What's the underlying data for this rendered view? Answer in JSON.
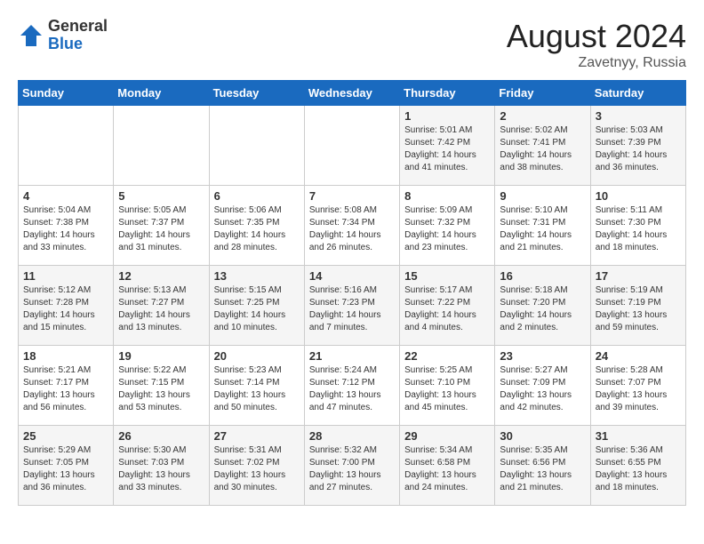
{
  "header": {
    "logo_general": "General",
    "logo_blue": "Blue",
    "title": "August 2024",
    "subtitle": "Zavetnyy, Russia"
  },
  "weekdays": [
    "Sunday",
    "Monday",
    "Tuesday",
    "Wednesday",
    "Thursday",
    "Friday",
    "Saturday"
  ],
  "weeks": [
    [
      {
        "day": "",
        "info": ""
      },
      {
        "day": "",
        "info": ""
      },
      {
        "day": "",
        "info": ""
      },
      {
        "day": "",
        "info": ""
      },
      {
        "day": "1",
        "info": "Sunrise: 5:01 AM\nSunset: 7:42 PM\nDaylight: 14 hours\nand 41 minutes."
      },
      {
        "day": "2",
        "info": "Sunrise: 5:02 AM\nSunset: 7:41 PM\nDaylight: 14 hours\nand 38 minutes."
      },
      {
        "day": "3",
        "info": "Sunrise: 5:03 AM\nSunset: 7:39 PM\nDaylight: 14 hours\nand 36 minutes."
      }
    ],
    [
      {
        "day": "4",
        "info": "Sunrise: 5:04 AM\nSunset: 7:38 PM\nDaylight: 14 hours\nand 33 minutes."
      },
      {
        "day": "5",
        "info": "Sunrise: 5:05 AM\nSunset: 7:37 PM\nDaylight: 14 hours\nand 31 minutes."
      },
      {
        "day": "6",
        "info": "Sunrise: 5:06 AM\nSunset: 7:35 PM\nDaylight: 14 hours\nand 28 minutes."
      },
      {
        "day": "7",
        "info": "Sunrise: 5:08 AM\nSunset: 7:34 PM\nDaylight: 14 hours\nand 26 minutes."
      },
      {
        "day": "8",
        "info": "Sunrise: 5:09 AM\nSunset: 7:32 PM\nDaylight: 14 hours\nand 23 minutes."
      },
      {
        "day": "9",
        "info": "Sunrise: 5:10 AM\nSunset: 7:31 PM\nDaylight: 14 hours\nand 21 minutes."
      },
      {
        "day": "10",
        "info": "Sunrise: 5:11 AM\nSunset: 7:30 PM\nDaylight: 14 hours\nand 18 minutes."
      }
    ],
    [
      {
        "day": "11",
        "info": "Sunrise: 5:12 AM\nSunset: 7:28 PM\nDaylight: 14 hours\nand 15 minutes."
      },
      {
        "day": "12",
        "info": "Sunrise: 5:13 AM\nSunset: 7:27 PM\nDaylight: 14 hours\nand 13 minutes."
      },
      {
        "day": "13",
        "info": "Sunrise: 5:15 AM\nSunset: 7:25 PM\nDaylight: 14 hours\nand 10 minutes."
      },
      {
        "day": "14",
        "info": "Sunrise: 5:16 AM\nSunset: 7:23 PM\nDaylight: 14 hours\nand 7 minutes."
      },
      {
        "day": "15",
        "info": "Sunrise: 5:17 AM\nSunset: 7:22 PM\nDaylight: 14 hours\nand 4 minutes."
      },
      {
        "day": "16",
        "info": "Sunrise: 5:18 AM\nSunset: 7:20 PM\nDaylight: 14 hours\nand 2 minutes."
      },
      {
        "day": "17",
        "info": "Sunrise: 5:19 AM\nSunset: 7:19 PM\nDaylight: 13 hours\nand 59 minutes."
      }
    ],
    [
      {
        "day": "18",
        "info": "Sunrise: 5:21 AM\nSunset: 7:17 PM\nDaylight: 13 hours\nand 56 minutes."
      },
      {
        "day": "19",
        "info": "Sunrise: 5:22 AM\nSunset: 7:15 PM\nDaylight: 13 hours\nand 53 minutes."
      },
      {
        "day": "20",
        "info": "Sunrise: 5:23 AM\nSunset: 7:14 PM\nDaylight: 13 hours\nand 50 minutes."
      },
      {
        "day": "21",
        "info": "Sunrise: 5:24 AM\nSunset: 7:12 PM\nDaylight: 13 hours\nand 47 minutes."
      },
      {
        "day": "22",
        "info": "Sunrise: 5:25 AM\nSunset: 7:10 PM\nDaylight: 13 hours\nand 45 minutes."
      },
      {
        "day": "23",
        "info": "Sunrise: 5:27 AM\nSunset: 7:09 PM\nDaylight: 13 hours\nand 42 minutes."
      },
      {
        "day": "24",
        "info": "Sunrise: 5:28 AM\nSunset: 7:07 PM\nDaylight: 13 hours\nand 39 minutes."
      }
    ],
    [
      {
        "day": "25",
        "info": "Sunrise: 5:29 AM\nSunset: 7:05 PM\nDaylight: 13 hours\nand 36 minutes."
      },
      {
        "day": "26",
        "info": "Sunrise: 5:30 AM\nSunset: 7:03 PM\nDaylight: 13 hours\nand 33 minutes."
      },
      {
        "day": "27",
        "info": "Sunrise: 5:31 AM\nSunset: 7:02 PM\nDaylight: 13 hours\nand 30 minutes."
      },
      {
        "day": "28",
        "info": "Sunrise: 5:32 AM\nSunset: 7:00 PM\nDaylight: 13 hours\nand 27 minutes."
      },
      {
        "day": "29",
        "info": "Sunrise: 5:34 AM\nSunset: 6:58 PM\nDaylight: 13 hours\nand 24 minutes."
      },
      {
        "day": "30",
        "info": "Sunrise: 5:35 AM\nSunset: 6:56 PM\nDaylight: 13 hours\nand 21 minutes."
      },
      {
        "day": "31",
        "info": "Sunrise: 5:36 AM\nSunset: 6:55 PM\nDaylight: 13 hours\nand 18 minutes."
      }
    ]
  ]
}
